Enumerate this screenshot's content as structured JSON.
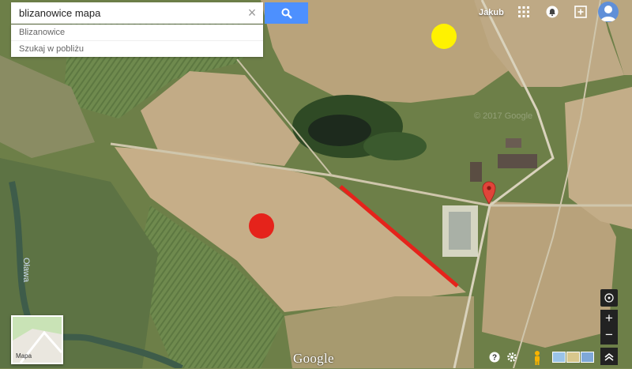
{
  "search": {
    "value": "blizanowice mapa",
    "button_icon": "search-icon",
    "clear_icon": "close-icon"
  },
  "suggestions": [
    {
      "label": "Blizanowice"
    },
    {
      "label": "Szukaj w pobliżu"
    }
  ],
  "header": {
    "user_name": "Jakub",
    "apps_icon": "apps-grid-icon",
    "notifications_icon": "notifications-icon",
    "share_icon": "add-share-icon",
    "avatar_icon": "user-avatar-icon"
  },
  "map": {
    "watermark": "© 2017 Google",
    "river_label": "Oława",
    "marker_colors": {
      "yellow": "#fff200",
      "red": "#e5231b",
      "line": "#e5231b",
      "pin": "#e0443a"
    }
  },
  "controls": {
    "compass_icon": "compass-icon",
    "zoom_in": "+",
    "zoom_out": "−",
    "expand_icon": "chevron-up-icon",
    "help_icon": "help-icon",
    "settings_icon": "gear-icon",
    "pegman_icon": "pegman-icon"
  },
  "thumbnail": {
    "label": "Mapa"
  },
  "branding": {
    "logo": "Google"
  }
}
